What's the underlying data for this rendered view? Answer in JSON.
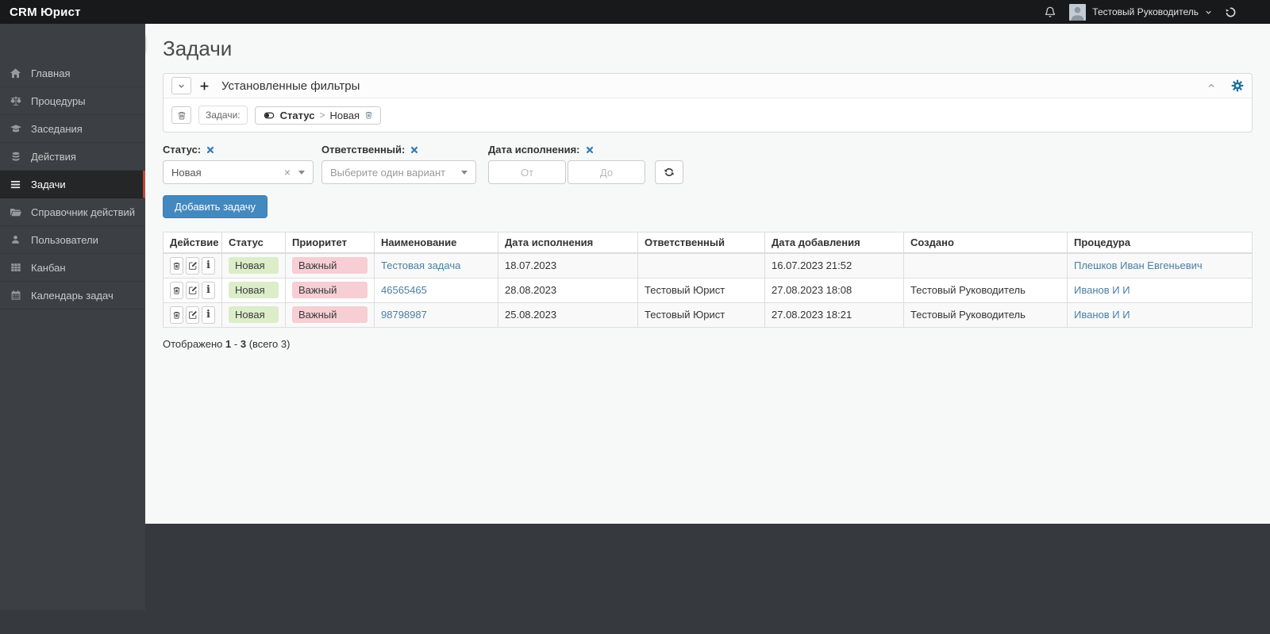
{
  "topbar": {
    "brand": "CRM Юрист",
    "user_name": "Тестовый Руководитель",
    "icons": [
      "bell-icon",
      "avatar",
      "chevron-down-icon",
      "history-icon"
    ]
  },
  "sidebar": {
    "items": [
      {
        "label": "Главная",
        "icon": "home-icon",
        "active": false
      },
      {
        "label": "Процедуры",
        "icon": "scales-icon",
        "active": false
      },
      {
        "label": "Заседания",
        "icon": "graduation-cap-icon",
        "active": false
      },
      {
        "label": "Действия",
        "icon": "database-icon",
        "active": false
      },
      {
        "label": "Задачи",
        "icon": "bars-icon",
        "active": true
      },
      {
        "label": "Справочник действий",
        "icon": "folder-open-icon",
        "active": false
      },
      {
        "label": "Пользователи",
        "icon": "user-icon",
        "active": false
      },
      {
        "label": "Канбан",
        "icon": "grid-icon",
        "active": false
      },
      {
        "label": "Календарь задач",
        "icon": "calendar-icon",
        "active": false
      }
    ]
  },
  "page": {
    "title": "Задачи"
  },
  "filters_panel": {
    "title": "Установленные фильтры",
    "entity_label": "Задачи:",
    "applied_filter": {
      "field": "Статус",
      "sep": ">",
      "value": "Новая"
    },
    "icons": [
      "chevron-down-icon",
      "plus-icon",
      "trash-icon",
      "toggle-icon",
      "chevron-up-icon",
      "gear-icon"
    ]
  },
  "filter_controls": {
    "status": {
      "label": "Статус:",
      "value": "Новая",
      "clear_symbol": "×"
    },
    "responsible": {
      "label": "Ответственный:",
      "placeholder": "Выберите один вариант"
    },
    "due_date": {
      "label": "Дата исполнения:",
      "from_placeholder": "От",
      "to_placeholder": "До"
    }
  },
  "add_task_button": "Добавить задачу",
  "table": {
    "headers": [
      "Действие",
      "Статус",
      "Приоритет",
      "Наименование",
      "Дата исполнения",
      "Ответственный",
      "Дата добавления",
      "Создано",
      "Процедура"
    ],
    "action_icons": [
      "trash-icon",
      "edit-icon",
      "info-icon"
    ],
    "info_glyph": "i",
    "rows": [
      {
        "status": "Новая",
        "priority": "Важный",
        "name": "Тестовая задача",
        "due": "18.07.2023",
        "responsible": "",
        "added": "16.07.2023 21:52",
        "created_by": "",
        "procedure": "Плешков Иван Евгеньевич"
      },
      {
        "status": "Новая",
        "priority": "Важный",
        "name": "46565465",
        "due": "28.08.2023",
        "responsible": "Тестовый Юрист",
        "added": "27.08.2023 18:08",
        "created_by": "Тестовый Руководитель",
        "procedure": "Иванов И И"
      },
      {
        "status": "Новая",
        "priority": "Важный",
        "name": "98798987",
        "due": "25.08.2023",
        "responsible": "Тестовый Юрист",
        "added": "27.08.2023 18:21",
        "created_by": "Тестовый Руководитель",
        "procedure": "Иванов И И"
      }
    ]
  },
  "footer": {
    "prefix": "Отображено",
    "from": "1",
    "dash": "-",
    "to": "3",
    "total": "(всего 3)"
  },
  "colors": {
    "topbar_bg": "#17191a",
    "sidebar_bg": "#3c4044",
    "sidebar_active_accent": "#bf4632",
    "primary_button": "#4389c0",
    "link": "#4a80a2",
    "status_new_bg": "#dcedc9",
    "priority_important_bg": "#f6ced4",
    "filter_clear_x": "#2d7cb8",
    "gear": "#1d7097"
  }
}
